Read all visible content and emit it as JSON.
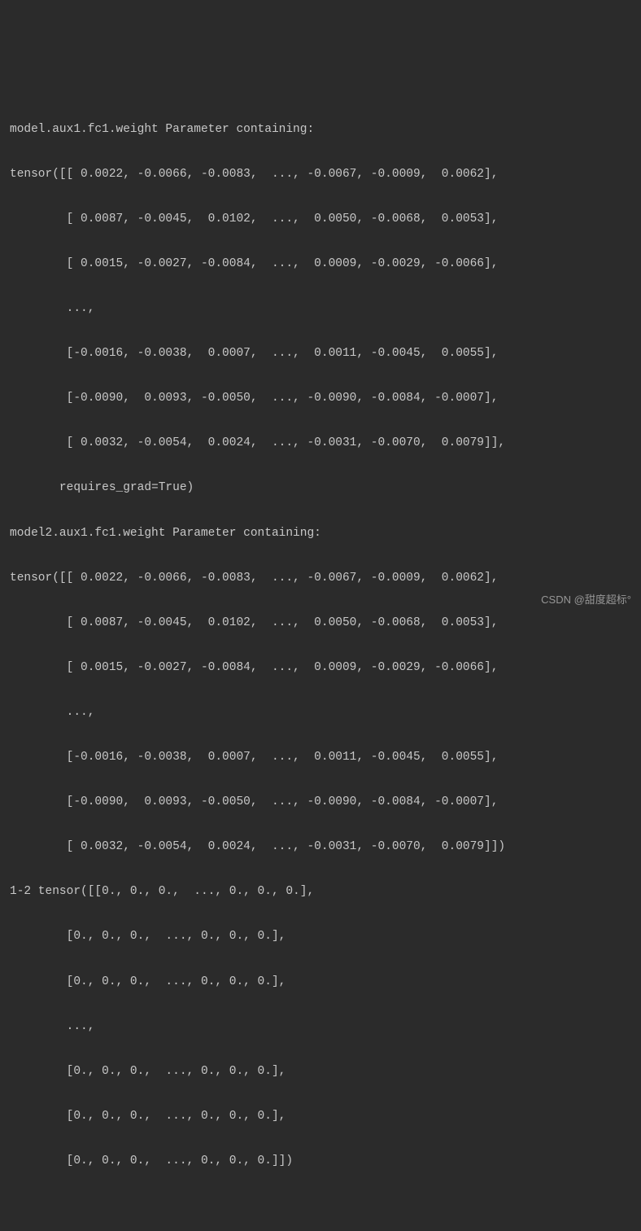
{
  "lines": {
    "l1": "model.aux1.fc1.weight Parameter containing:",
    "l2": "tensor([[ 0.0022, -0.0066, -0.0083,  ..., -0.0067, -0.0009,  0.0062],",
    "l3": "        [ 0.0087, -0.0045,  0.0102,  ...,  0.0050, -0.0068,  0.0053],",
    "l4": "        [ 0.0015, -0.0027, -0.0084,  ...,  0.0009, -0.0029, -0.0066],",
    "l5": "        ...,",
    "l6": "        [-0.0016, -0.0038,  0.0007,  ...,  0.0011, -0.0045,  0.0055],",
    "l7": "        [-0.0090,  0.0093, -0.0050,  ..., -0.0090, -0.0084, -0.0007],",
    "l8": "        [ 0.0032, -0.0054,  0.0024,  ..., -0.0031, -0.0070,  0.0079]],",
    "l9": "       requires_grad=True)",
    "l10": "model2.aux1.fc1.weight Parameter containing:",
    "l11": "tensor([[ 0.0022, -0.0066, -0.0083,  ..., -0.0067, -0.0009,  0.0062],",
    "l12": "        [ 0.0087, -0.0045,  0.0102,  ...,  0.0050, -0.0068,  0.0053],",
    "l13": "        [ 0.0015, -0.0027, -0.0084,  ...,  0.0009, -0.0029, -0.0066],",
    "l14": "        ...,",
    "l15": "        [-0.0016, -0.0038,  0.0007,  ...,  0.0011, -0.0045,  0.0055],",
    "l16": "        [-0.0090,  0.0093, -0.0050,  ..., -0.0090, -0.0084, -0.0007],",
    "l17": "        [ 0.0032, -0.0054,  0.0024,  ..., -0.0031, -0.0070,  0.0079]])",
    "l18": "1-2 tensor([[0., 0., 0.,  ..., 0., 0., 0.],",
    "l19": "        [0., 0., 0.,  ..., 0., 0., 0.],",
    "l20": "        [0., 0., 0.,  ..., 0., 0., 0.],",
    "l21": "        ...,",
    "l22": "        [0., 0., 0.,  ..., 0., 0., 0.],",
    "l23": "        [0., 0., 0.,  ..., 0., 0., 0.],",
    "l24": "        [0., 0., 0.,  ..., 0., 0., 0.]])"
  },
  "watermark": "CSDN @甜度超标°"
}
